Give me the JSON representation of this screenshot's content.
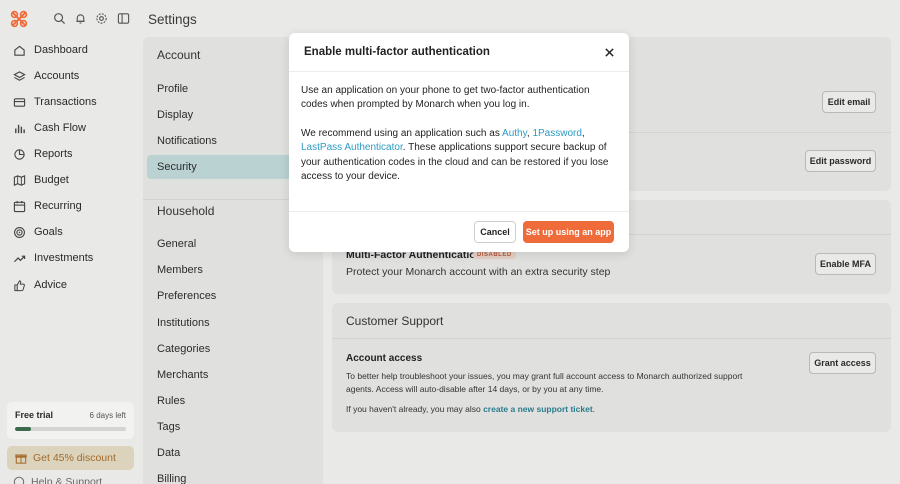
{
  "header": {
    "title": "Settings"
  },
  "sidebar": {
    "items": [
      {
        "label": "Dashboard",
        "icon": "home-icon"
      },
      {
        "label": "Accounts",
        "icon": "layers-icon"
      },
      {
        "label": "Transactions",
        "icon": "credit-card-icon"
      },
      {
        "label": "Cash Flow",
        "icon": "bar-chart-icon"
      },
      {
        "label": "Reports",
        "icon": "pie-chart-icon"
      },
      {
        "label": "Budget",
        "icon": "map-icon"
      },
      {
        "label": "Recurring",
        "icon": "calendar-icon"
      },
      {
        "label": "Goals",
        "icon": "target-icon"
      },
      {
        "label": "Investments",
        "icon": "trending-up-icon"
      },
      {
        "label": "Advice",
        "icon": "thumbs-up-icon"
      }
    ],
    "trial": {
      "title": "Free trial",
      "days_left": "6 days left",
      "progress": 0.14
    },
    "discount_label": "Get 45% discount",
    "help_label": "Help & Support"
  },
  "settings": {
    "account_heading": "Account",
    "account_items": [
      "Profile",
      "Display",
      "Notifications",
      "Security"
    ],
    "active_item": "Security",
    "household_heading": "Household",
    "household_items": [
      "General",
      "Members",
      "Preferences",
      "Institutions",
      "Categories",
      "Merchants",
      "Rules",
      "Tags",
      "Data",
      "Billing"
    ]
  },
  "security": {
    "edit_email_label": "Edit email",
    "edit_password_label": "Edit password",
    "mfa_title": "Multi-Factor Authentication",
    "mfa_badge": "DISABLED",
    "mfa_desc": "Protect your Monarch account with an extra security step",
    "enable_mfa_label": "Enable MFA"
  },
  "support": {
    "title": "Customer Support",
    "access_title": "Account access",
    "access_desc": "To better help troubleshoot your issues, you may grant full account access to Monarch authorized support agents. Access will auto-disable after 14 days, or by you at any time.",
    "grant_label": "Grant access",
    "note_prefix": "If you haven't already, you may also ",
    "note_link": "create a new support ticket",
    "note_suffix": "."
  },
  "modal": {
    "title": "Enable multi-factor authentication",
    "para1": "Use an application on your phone to get two-factor authentication codes when prompted by Monarch when you log in.",
    "para2_prefix": "We recommend using an application such as ",
    "link_authy": "Authy",
    "sep1": ", ",
    "link_1password": "1Password",
    "sep2": ",",
    "link_lastpass": "LastPass Authenticator",
    "para2_suffix": ". These applications support secure backup of your authentication codes in the cloud and can be restored if you lose access to your device.",
    "cancel_label": "Cancel",
    "primary_label": "Set up using an app"
  },
  "colors": {
    "accent": "#f06b3a",
    "link": "#2d9bc4",
    "active_nav": "#bad2d2",
    "badge": "#b45a3c"
  }
}
